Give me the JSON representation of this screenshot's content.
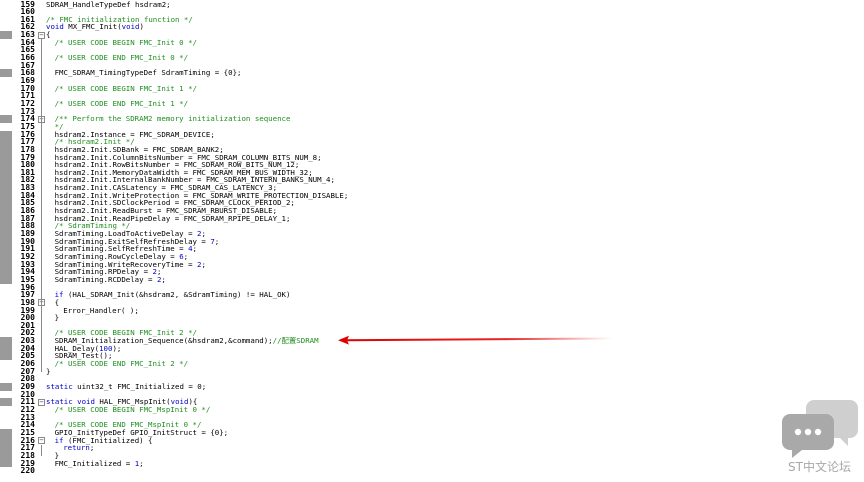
{
  "editor": {
    "lines": [
      {
        "n": "159",
        "text": "SDRAM_HandleTypeDef hsdram2;",
        "indent": 0,
        "style": "plain"
      },
      {
        "n": "160",
        "text": "",
        "indent": 0,
        "style": "plain"
      },
      {
        "n": "161",
        "text": "/* FMC initialization function */",
        "indent": 0,
        "style": "comment"
      },
      {
        "n": "162",
        "text": "void MX_FMC_Init(void)",
        "indent": 0,
        "style": "voidfn"
      },
      {
        "n": "163",
        "text": "{",
        "indent": 0,
        "style": "plain"
      },
      {
        "n": "164",
        "text": "/* USER CODE BEGIN FMC_Init 0 */",
        "indent": 1,
        "style": "comment"
      },
      {
        "n": "165",
        "text": "",
        "indent": 0,
        "style": "plain"
      },
      {
        "n": "166",
        "text": "/* USER CODE END FMC_Init 0 */",
        "indent": 1,
        "style": "comment"
      },
      {
        "n": "167",
        "text": "",
        "indent": 0,
        "style": "plain"
      },
      {
        "n": "168",
        "text": "FMC_SDRAM_TimingTypeDef SdramTiming = {0};",
        "indent": 1,
        "style": "plain"
      },
      {
        "n": "169",
        "text": "",
        "indent": 0,
        "style": "plain"
      },
      {
        "n": "170",
        "text": "/* USER CODE BEGIN FMC_Init 1 */",
        "indent": 1,
        "style": "comment"
      },
      {
        "n": "171",
        "text": "",
        "indent": 0,
        "style": "plain"
      },
      {
        "n": "172",
        "text": "/* USER CODE END FMC_Init 1 */",
        "indent": 1,
        "style": "comment"
      },
      {
        "n": "173",
        "text": "",
        "indent": 0,
        "style": "plain"
      },
      {
        "n": "174",
        "text": "/** Perform the SDRAM2 memory initialization sequence",
        "indent": 1,
        "style": "comment"
      },
      {
        "n": "175",
        "text": "*/",
        "indent": 1,
        "style": "comment"
      },
      {
        "n": "176",
        "text": "hsdram2.Instance = FMC_SDRAM_DEVICE;",
        "indent": 1,
        "style": "plain"
      },
      {
        "n": "177",
        "text": "/* hsdram2.Init */",
        "indent": 1,
        "style": "comment"
      },
      {
        "n": "178",
        "text": "hsdram2.Init.SDBank = FMC_SDRAM_BANK2;",
        "indent": 1,
        "style": "plain"
      },
      {
        "n": "179",
        "text": "hsdram2.Init.ColumnBitsNumber = FMC_SDRAM_COLUMN_BITS_NUM_8;",
        "indent": 1,
        "style": "plain"
      },
      {
        "n": "180",
        "text": "hsdram2.Init.RowBitsNumber = FMC_SDRAM_ROW_BITS_NUM_12;",
        "indent": 1,
        "style": "plain"
      },
      {
        "n": "181",
        "text": "hsdram2.Init.MemoryDataWidth = FMC_SDRAM_MEM_BUS_WIDTH_32;",
        "indent": 1,
        "style": "plain"
      },
      {
        "n": "182",
        "text": "hsdram2.Init.InternalBankNumber = FMC_SDRAM_INTERN_BANKS_NUM_4;",
        "indent": 1,
        "style": "plain"
      },
      {
        "n": "183",
        "text": "hsdram2.Init.CASLatency = FMC_SDRAM_CAS_LATENCY_3;",
        "indent": 1,
        "style": "plain"
      },
      {
        "n": "184",
        "text": "hsdram2.Init.WriteProtection = FMC_SDRAM_WRITE_PROTECTION_DISABLE;",
        "indent": 1,
        "style": "plain"
      },
      {
        "n": "185",
        "text": "hsdram2.Init.SDClockPeriod = FMC_SDRAM_CLOCK_PERIOD_2;",
        "indent": 1,
        "style": "plain"
      },
      {
        "n": "186",
        "text": "hsdram2.Init.ReadBurst = FMC_SDRAM_RBURST_DISABLE;",
        "indent": 1,
        "style": "plain"
      },
      {
        "n": "187",
        "text": "hsdram2.Init.ReadPipeDelay = FMC_SDRAM_RPIPE_DELAY_1;",
        "indent": 1,
        "style": "plain"
      },
      {
        "n": "188",
        "text": "/* SdramTiming */",
        "indent": 1,
        "style": "comment"
      },
      {
        "n": "189",
        "text": "SdramTiming.LoadToActiveDelay = 2;",
        "indent": 1,
        "style": "num"
      },
      {
        "n": "190",
        "text": "SdramTiming.ExitSelfRefreshDelay = 7;",
        "indent": 1,
        "style": "num"
      },
      {
        "n": "191",
        "text": "SdramTiming.SelfRefreshTime = 4;",
        "indent": 1,
        "style": "num"
      },
      {
        "n": "192",
        "text": "SdramTiming.RowCycleDelay = 6;",
        "indent": 1,
        "style": "num"
      },
      {
        "n": "193",
        "text": "SdramTiming.WriteRecoveryTime = 2;",
        "indent": 1,
        "style": "num"
      },
      {
        "n": "194",
        "text": "SdramTiming.RPDelay = 2;",
        "indent": 1,
        "style": "num"
      },
      {
        "n": "195",
        "text": "SdramTiming.RCDDelay = 2;",
        "indent": 1,
        "style": "num"
      },
      {
        "n": "196",
        "text": "",
        "indent": 0,
        "style": "plain"
      },
      {
        "n": "197",
        "text": "if (HAL_SDRAM_Init(&hsdram2, &SdramTiming) != HAL_OK)",
        "indent": 1,
        "style": "if"
      },
      {
        "n": "198",
        "text": "{",
        "indent": 1,
        "style": "plain"
      },
      {
        "n": "199",
        "text": "Error_Handler( );",
        "indent": 2,
        "style": "plain"
      },
      {
        "n": "200",
        "text": "}",
        "indent": 1,
        "style": "plain"
      },
      {
        "n": "201",
        "text": "",
        "indent": 0,
        "style": "plain"
      },
      {
        "n": "202",
        "text": "/* USER CODE BEGIN FMC_Init 2 */",
        "indent": 1,
        "style": "comment"
      },
      {
        "n": "203",
        "text": "SDRAM_Initialization_Sequence(&hsdram2,&command);",
        "indent": 1,
        "style": "plain",
        "trail": "//配置SDRAM"
      },
      {
        "n": "204",
        "text": "HAL_Delay(100);",
        "indent": 1,
        "style": "num"
      },
      {
        "n": "205",
        "text": "SDRAM_Test();",
        "indent": 1,
        "style": "plain"
      },
      {
        "n": "206",
        "text": "/* USER CODE END FMC_Init 2 */",
        "indent": 1,
        "style": "comment"
      },
      {
        "n": "207",
        "text": "}",
        "indent": 0,
        "style": "plain"
      },
      {
        "n": "208",
        "text": "",
        "indent": 0,
        "style": "plain"
      },
      {
        "n": "209",
        "text": "static uint32_t FMC_Initialized = 0;",
        "indent": 0,
        "style": "static"
      },
      {
        "n": "210",
        "text": "",
        "indent": 0,
        "style": "plain"
      },
      {
        "n": "211",
        "text": "static void HAL_FMC_MspInit(void){",
        "indent": 0,
        "style": "static"
      },
      {
        "n": "212",
        "text": "/* USER CODE BEGIN FMC_MspInit 0 */",
        "indent": 1,
        "style": "comment"
      },
      {
        "n": "213",
        "text": "",
        "indent": 0,
        "style": "plain"
      },
      {
        "n": "214",
        "text": "/* USER CODE END FMC_MspInit 0 */",
        "indent": 1,
        "style": "comment"
      },
      {
        "n": "215",
        "text": "GPIO_InitTypeDef GPIO_InitStruct = {0};",
        "indent": 1,
        "style": "plain"
      },
      {
        "n": "216",
        "text": "if (FMC_Initialized) {",
        "indent": 1,
        "style": "if"
      },
      {
        "n": "217",
        "text": "return;",
        "indent": 2,
        "style": "ret"
      },
      {
        "n": "218",
        "text": "}",
        "indent": 1,
        "style": "plain"
      },
      {
        "n": "219",
        "text": "FMC_Initialized = 1;",
        "indent": 1,
        "style": "num"
      },
      {
        "n": "220",
        "text": "",
        "indent": 0,
        "style": "plain"
      }
    ]
  },
  "watermark": {
    "text": "ST中文论坛"
  },
  "colors": {
    "comment": "#1f8f1f",
    "keyword": "#0000c8",
    "arrow": "#e00000",
    "marker": "#9a9a9a"
  }
}
